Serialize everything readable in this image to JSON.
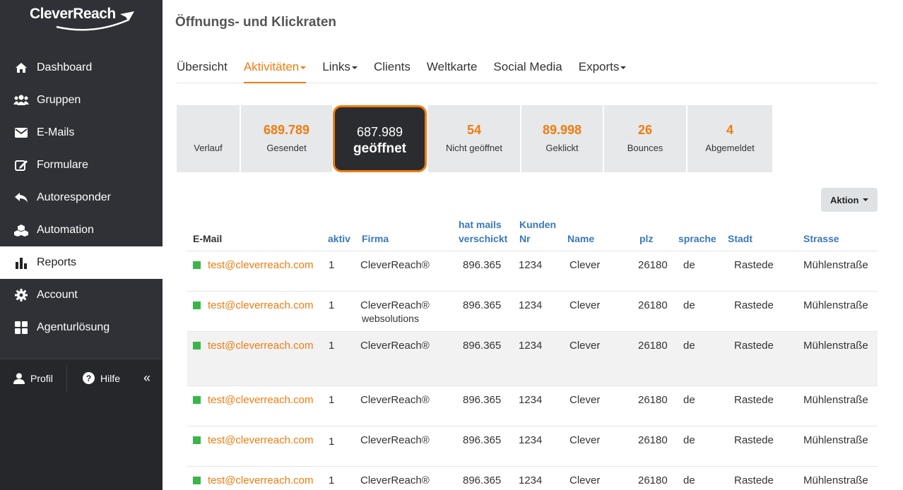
{
  "brand": {
    "name": "CleverReach"
  },
  "sidebar": {
    "items": [
      {
        "label": "Dashboard",
        "icon": "home-icon"
      },
      {
        "label": "Gruppen",
        "icon": "users-icon"
      },
      {
        "label": "E-Mails",
        "icon": "envelope-icon"
      },
      {
        "label": "Formulare",
        "icon": "edit-icon"
      },
      {
        "label": "Autoresponder",
        "icon": "reply-icon"
      },
      {
        "label": "Automation",
        "icon": "cubes-icon"
      },
      {
        "label": "Reports",
        "icon": "bar-chart-icon",
        "active": true
      },
      {
        "label": "Account",
        "icon": "gear-icon"
      },
      {
        "label": "Agenturlösung",
        "icon": "grid-icon"
      }
    ],
    "bottom": {
      "profil": "Profil",
      "hilfe": "Hilfe",
      "collapse": "«"
    }
  },
  "page": {
    "title": "Öffnungs- und Klickraten"
  },
  "tabs": [
    {
      "label": "Übersicht"
    },
    {
      "label": "Aktivitäten",
      "dropdown": true,
      "active": true
    },
    {
      "label": "Links",
      "dropdown": true
    },
    {
      "label": "Clients"
    },
    {
      "label": "Weltkarte"
    },
    {
      "label": "Social Media"
    },
    {
      "label": "Exports",
      "dropdown": true
    }
  ],
  "stats": [
    {
      "value": "",
      "label": "Verlauf"
    },
    {
      "value": "689.789",
      "label": "Gesendet"
    },
    {
      "value": "687.989",
      "label": "geöffnet",
      "highlighted": true
    },
    {
      "value": "54",
      "label": "Nicht geöffnet"
    },
    {
      "value": "89.998",
      "label": "Geklickt"
    },
    {
      "value": "26",
      "label": "Bounces"
    },
    {
      "value": "4",
      "label": "Abgemeldet"
    }
  ],
  "action_button": "Aktion",
  "table": {
    "headers": {
      "email": "E-Mail",
      "aktiv": "aktiv",
      "firma": "Firma",
      "mails1": "hat mails",
      "mails2": "verschickt",
      "kunden1": "Kunden",
      "kunden2": "Nr",
      "name": "Name",
      "plz": "plz",
      "sprache": "sprache",
      "stadt": "Stadt",
      "strasse": "Strasse"
    },
    "rows": [
      {
        "email": "test@cleverreach.com",
        "aktiv": "1",
        "firma": "CleverReach®",
        "firma2": "",
        "mails": "896.365",
        "kunden": "1234",
        "name": "Clever",
        "plz": "26180",
        "sprache": "de",
        "stadt": "Rastede",
        "strasse": "Mühlenstraße"
      },
      {
        "email": "test@cleverreach.com",
        "aktiv": "1",
        "firma": "CleverReach®",
        "firma2": "websolutions",
        "mails": "896.365",
        "kunden": "1234",
        "name": "Clever",
        "plz": "26180",
        "sprache": "de",
        "stadt": "Rastede",
        "strasse": "Mühlenstraße"
      },
      {
        "email": "test@cleverreach.com",
        "aktiv": "1",
        "firma": "CleverReach®",
        "firma2": "",
        "mails": "896.365",
        "kunden": "1234",
        "name": "Clever",
        "plz": "26180",
        "sprache": "de",
        "stadt": "Rastede",
        "strasse": "Mühlenstraße"
      },
      {
        "email": "test@cleverreach.com",
        "aktiv": "1",
        "firma": "CleverReach®",
        "firma2": "",
        "mails": "896.365",
        "kunden": "1234",
        "name": "Clever",
        "plz": "26180",
        "sprache": "de",
        "stadt": "Rastede",
        "strasse": "Mühlenstraße"
      },
      {
        "email": "test@cleverreach.com",
        "aktiv": "1",
        "firma": "CleverReach®",
        "firma2": "",
        "mails": "896.365",
        "kunden": "1234",
        "name": "Clever",
        "plz": "26180",
        "sprache": "de",
        "stadt": "Rastede",
        "strasse": "Mühlenstraße"
      },
      {
        "email": "test@cleverreach.com",
        "aktiv": "1",
        "firma": "CleverReach®",
        "firma2": "",
        "mails": "896.365",
        "kunden": "1234",
        "name": "Clever",
        "plz": "26180",
        "sprache": "de",
        "stadt": "Rastede",
        "strasse": "Mühlenstraße"
      }
    ]
  },
  "colors": {
    "accent": "#f07c0f",
    "sidebar": "#2f3136",
    "link_header": "#3a78b8",
    "status_active": "#3bb54a"
  }
}
